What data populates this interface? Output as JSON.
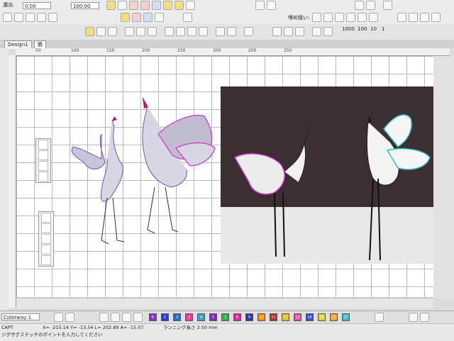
{
  "toolbar1": {
    "density_label": "濃淡:",
    "density_value": "0.00",
    "scale_value": "100.00"
  },
  "toolbar2": {
    "fill_label": "埋め縫い:",
    "counts": [
      "1000",
      "100",
      "10",
      "1"
    ]
  },
  "tabs": [
    {
      "label": "Design1"
    },
    {
      "label": "鶴"
    }
  ],
  "ruler": {
    "top": [
      "50",
      "100",
      "150",
      "200",
      "250",
      "300"
    ],
    "top_extra": [
      "200",
      "250"
    ]
  },
  "palette": {
    "colorway": "Colorway 1",
    "swatches": [
      {
        "label": "6",
        "color": "#8b2fc9"
      },
      {
        "label": "1",
        "color": "#2b3fd4"
      },
      {
        "label": "2",
        "color": "#1f6fd1"
      },
      {
        "label": "3",
        "color": "#e53ba0"
      },
      {
        "label": "4",
        "color": "#2fa6c9"
      },
      {
        "label": "5",
        "color": "#7a2fb0"
      },
      {
        "label": "7",
        "color": "#2fb34a"
      },
      {
        "label": "8",
        "color": "#d62f8b"
      },
      {
        "label": "9",
        "color": "#2a3a9e"
      },
      {
        "label": "10",
        "color": "#f08c1a"
      },
      {
        "label": "11",
        "color": "#b02f2f"
      },
      {
        "label": "12",
        "color": "#e0c02f"
      },
      {
        "label": "13",
        "color": "#e84d9a"
      },
      {
        "label": "14",
        "color": "#3a4fc8"
      },
      {
        "label": "15",
        "color": "#d9d22f"
      },
      {
        "label": "16",
        "color": "#f0a02f"
      },
      {
        "label": "17",
        "color": "#3ac0c0"
      }
    ]
  },
  "status": {
    "mode": "CAPT",
    "coords": "X= -215.14 Y= -13.54 L= 202.89 A= -15.07",
    "running": "ランニング長さ 2.50 mm",
    "hint": "ジグザグステッチのポイントを入力してください"
  },
  "colors": {
    "accent": "#d4a017",
    "photo_bg": "#3b2f33",
    "magenta": "#d432c8",
    "cyan": "#2bbfc4"
  }
}
